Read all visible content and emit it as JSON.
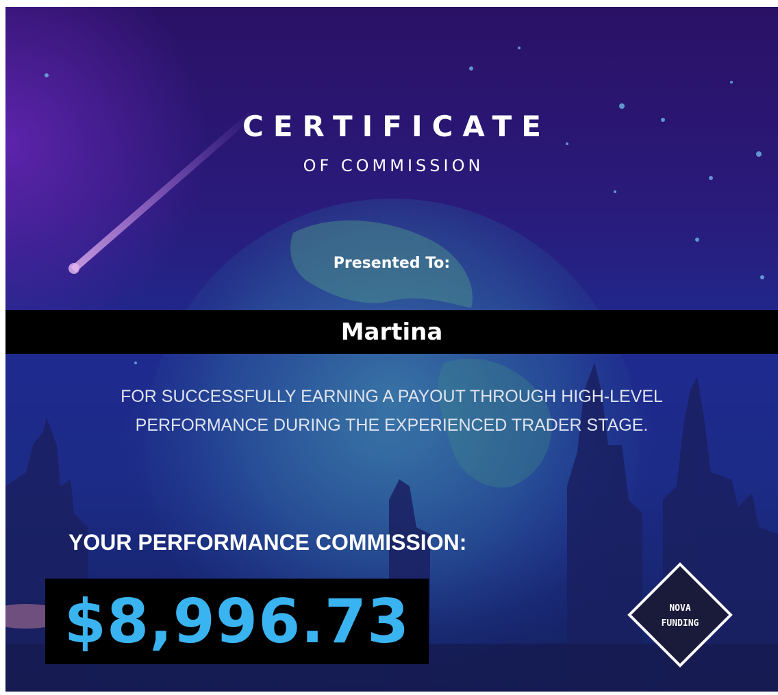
{
  "certificate": {
    "title": "CERTIFICATE",
    "subtitle": "OF COMMISSION",
    "presented_label": "Presented To:",
    "recipient_name": "Martina",
    "description_lines": [
      "FOR SUCCESSFULLY EARNING A PAYOUT THROUGH HIGH-LEVEL",
      "PERFORMANCE DURING THE EXPERIENCED TRADER STAGE."
    ],
    "commission_label": "YOUR PERFORMANCE COMMISSION:",
    "commission_amount": "$8,996.73"
  },
  "logo": {
    "line1": "NOVA",
    "line2": "FUNDING"
  },
  "colors": {
    "amount": "#3ab4f0",
    "background_top": "#2a1166",
    "background_bottom": "#14215e",
    "bar": "#000000"
  }
}
